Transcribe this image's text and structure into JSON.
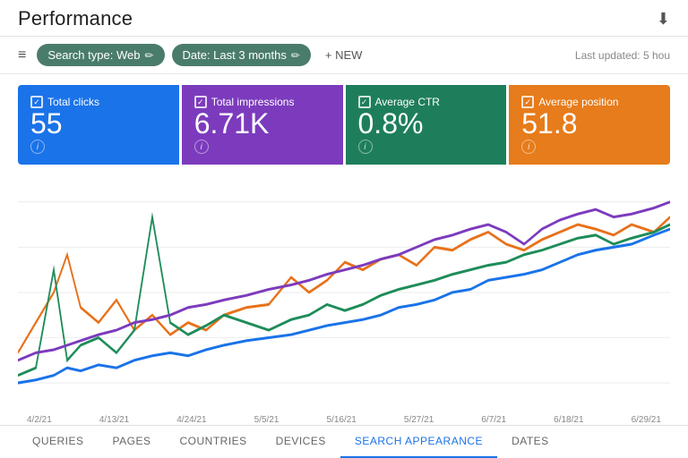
{
  "header": {
    "title": "Performance",
    "last_updated": "Last updated: 5 hou"
  },
  "toolbar": {
    "search_type_label": "Search type: Web",
    "date_label": "Date: Last 3 months",
    "new_button": "+ NEW"
  },
  "metrics": [
    {
      "id": "total-clicks",
      "label": "Total clicks",
      "value": "55",
      "color": "blue"
    },
    {
      "id": "total-impressions",
      "label": "Total impressions",
      "value": "6.71K",
      "color": "purple"
    },
    {
      "id": "average-ctr",
      "label": "Average CTR",
      "value": "0.8%",
      "color": "green"
    },
    {
      "id": "average-position",
      "label": "Average position",
      "value": "51.8",
      "color": "orange"
    }
  ],
  "chart": {
    "x_labels": [
      "4/2/21",
      "4/13/21",
      "4/24/21",
      "5/5/21",
      "5/16/21",
      "5/27/21",
      "6/7/21",
      "6/18/21",
      "6/29/21"
    ]
  },
  "tabs": [
    {
      "id": "queries",
      "label": "QUERIES",
      "active": false
    },
    {
      "id": "pages",
      "label": "PAGES",
      "active": false
    },
    {
      "id": "countries",
      "label": "COUNTRIES",
      "active": false
    },
    {
      "id": "devices",
      "label": "DEVICES",
      "active": false
    },
    {
      "id": "search-appearance",
      "label": "SEARCH APPEARANCE",
      "active": true
    },
    {
      "id": "dates",
      "label": "DATES",
      "active": false
    }
  ]
}
